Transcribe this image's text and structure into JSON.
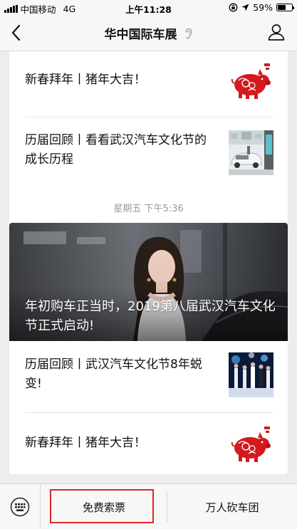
{
  "status_bar": {
    "carrier": "中国移动",
    "network": "4G",
    "time": "上午11:28",
    "battery_percent": "59%",
    "battery_level": 0.59,
    "icons": [
      "signal-bars-icon",
      "lock-rotation-icon",
      "location-arrow-icon",
      "battery-icon"
    ]
  },
  "nav": {
    "title": "华中国际车展",
    "icons": [
      "back-chevron-icon",
      "ear-icon",
      "profile-icon"
    ]
  },
  "feed": {
    "card1": {
      "articles": [
        {
          "title": "新春拜年丨猪年大吉！",
          "thumb": "red-pig-papercut"
        },
        {
          "title": "历届回顾丨看看武汉汽车文化节的成长历程",
          "thumb": "car-showroom-photo"
        }
      ]
    },
    "timestamp": "星期五 下午5:36",
    "card2": {
      "hero_title": "年初购车正当时，2019第八届武汉汽车文化节正式启动!",
      "articles": [
        {
          "title": "历届回顾丨武汉汽车文化节8年蜕变!",
          "thumb": "stage-models-photo"
        },
        {
          "title": "新春拜年丨猪年大吉！",
          "thumb": "red-pig-papercut"
        }
      ]
    }
  },
  "bottom_menu": {
    "items": [
      {
        "label": "免费索票"
      },
      {
        "label": "万人砍车团"
      }
    ],
    "highlight_color": "#e0262a"
  }
}
